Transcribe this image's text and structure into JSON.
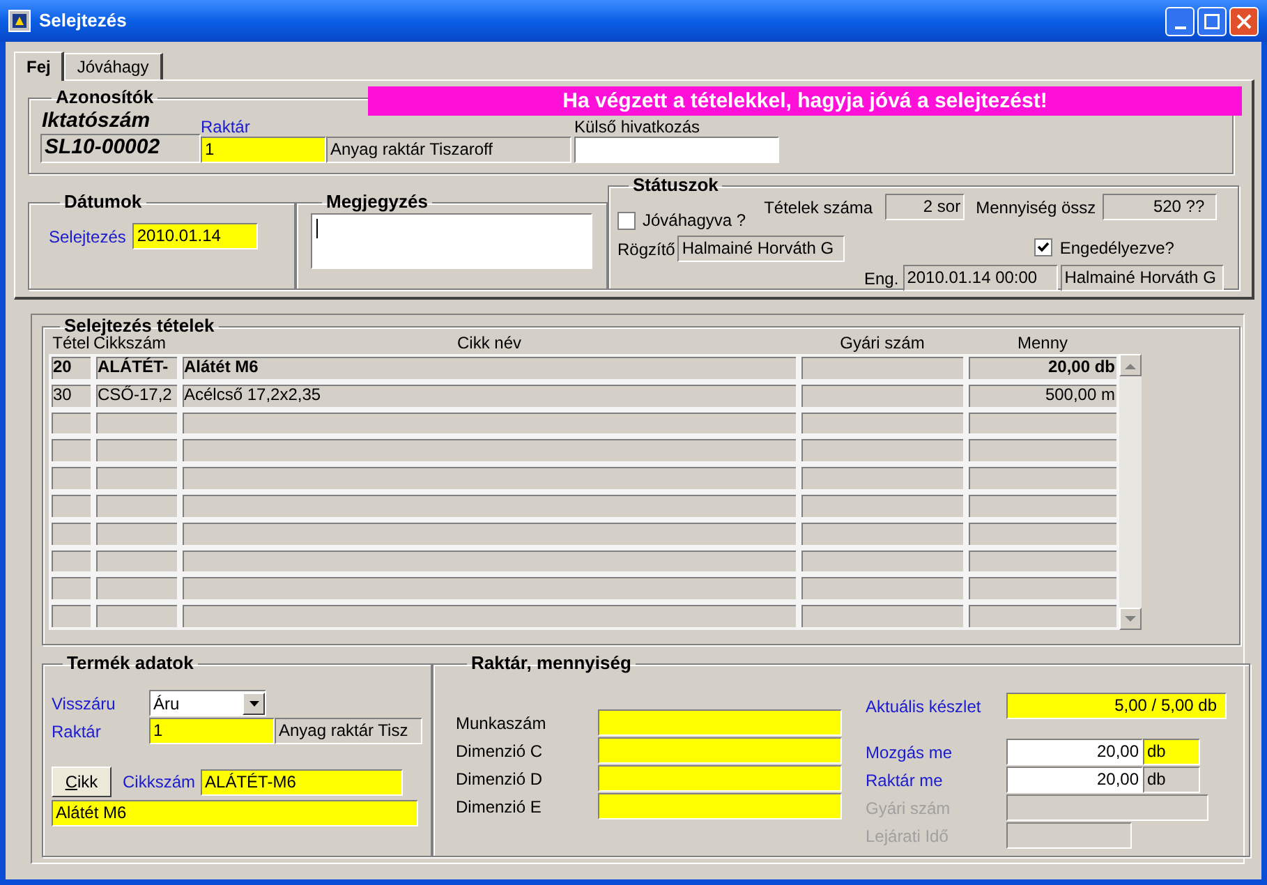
{
  "window": {
    "title": "Selejtezés"
  },
  "tabs": [
    {
      "label": "Fej",
      "selected": true
    },
    {
      "label": "Jóváhagy",
      "selected": false
    }
  ],
  "banner": "Ha végzett a tételekkel, hagyja jóvá a selejtezést!",
  "identifiers": {
    "title": "Azonosítók",
    "doc_label": "Iktatószám",
    "doc_number": "SL10-00002",
    "warehouse_label": "Raktár",
    "warehouse_code": "1",
    "warehouse_name": "Anyag raktár Tiszaroff",
    "external_ref_label": "Külső hivatkozás"
  },
  "dates": {
    "title": "Dátumok",
    "label": "Selejtezés",
    "value": "2010.01.14"
  },
  "note": {
    "title": "Megjegyzés"
  },
  "statuses": {
    "title": "Státuszok",
    "approved": {
      "label": "Jóváhagyva ?",
      "checked": false
    },
    "item_count_label": "Tételek száma",
    "item_count": "2 sor",
    "quantity_total_label": "Mennyiség össz",
    "quantity_total": "520 ??",
    "recorder_label": "Rögzítő",
    "recorder": "Halmainé Horváth G",
    "permitted": {
      "label": "Engedélyezve?",
      "checked": true
    },
    "permit_label": "Eng.",
    "permit_date": "2010.01.14 00:00",
    "permit_by": "Halmainé Horváth G"
  },
  "items": {
    "title": "Selejtezés tételek",
    "columns": [
      "Tétel",
      "Cikkszám",
      "Cikk név",
      "Gyári szám",
      "Menny"
    ],
    "rows": [
      {
        "cells": [
          "20",
          "ALÁTÉT-",
          "Alátét M6",
          null,
          "20,00 db"
        ],
        "selected": true
      },
      {
        "cells": [
          "30",
          "CSŐ-17,2",
          "Acélcső 17,2x2,35",
          null,
          "500,00 m"
        ],
        "selected": false
      }
    ]
  },
  "product": {
    "title": "Termék adatok",
    "return_label": "Visszáru",
    "return_value": "Áru",
    "warehouse_label": "Raktár",
    "warehouse_code": "1",
    "warehouse_name": "Anyag raktár Tisz",
    "item_button": "Cikk",
    "item_no_label": "Cikkszám",
    "item_no": "ALÁTÉT-M6",
    "item_name": "Alátét M6"
  },
  "stock": {
    "title": "Raktár, mennyiség",
    "fields": [
      {
        "label": "Munkaszám"
      },
      {
        "label": "Dimenzió C"
      },
      {
        "label": "Dimenzió D"
      },
      {
        "label": "Dimenzió E"
      }
    ],
    "current_stock_label": "Aktuális készlet",
    "current_stock": "5,00 / 5,00 db",
    "rows": [
      {
        "label": "Mozgás me",
        "value": "20,00",
        "unit": "db",
        "unit_editable": true,
        "disabled": false
      },
      {
        "label": "Raktár me",
        "value": "20,00",
        "unit": "db",
        "unit_editable": false,
        "disabled": false
      },
      {
        "label": "Gyári szám",
        "disabled": true
      },
      {
        "label": "Lejárati Idő",
        "disabled": true
      }
    ]
  }
}
